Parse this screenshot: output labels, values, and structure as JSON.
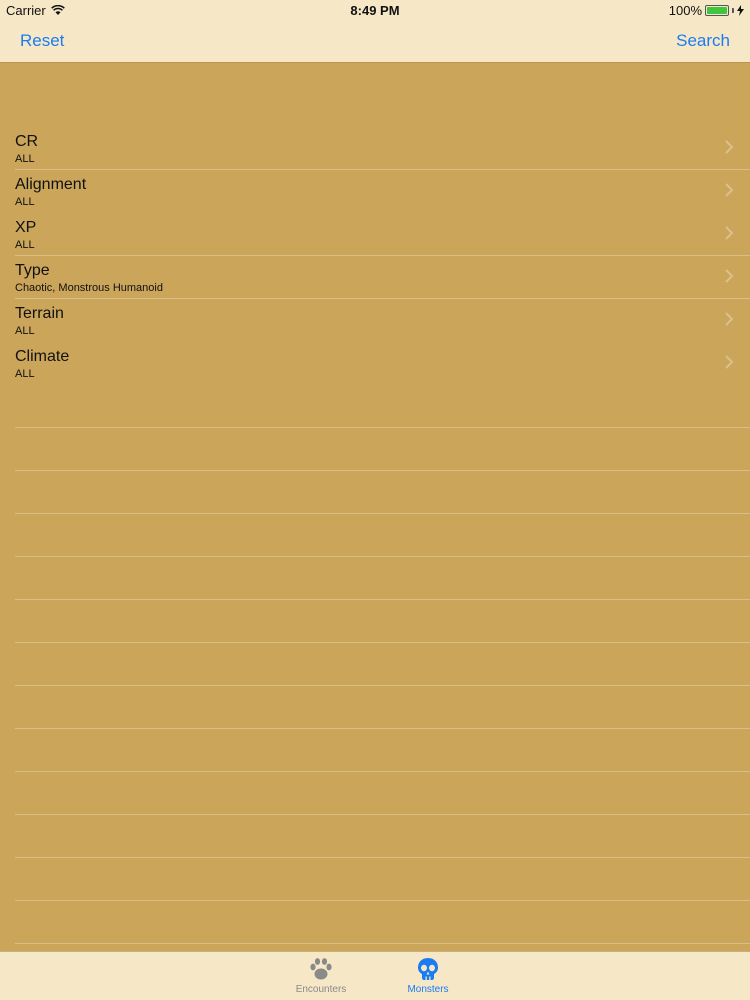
{
  "status_bar": {
    "carrier": "Carrier",
    "time": "8:49 PM",
    "battery": "100%"
  },
  "nav": {
    "reset_label": "Reset",
    "search_label": "Search"
  },
  "filters": [
    {
      "title": "CR",
      "value": "ALL"
    },
    {
      "title": "Alignment",
      "value": "ALL"
    },
    {
      "title": "XP",
      "value": "ALL"
    },
    {
      "title": "Type",
      "value": "Chaotic, Monstrous Humanoid"
    },
    {
      "title": "Terrain",
      "value": "ALL"
    },
    {
      "title": "Climate",
      "value": "ALL"
    }
  ],
  "tabs": [
    {
      "label": "Encounters",
      "icon": "paw-icon",
      "selected": false
    },
    {
      "label": "Monsters",
      "icon": "skull-icon",
      "selected": true
    }
  ],
  "colors": {
    "background": "#cba55a",
    "bar": "#f6e7c6",
    "accent": "#1a7cf2"
  }
}
